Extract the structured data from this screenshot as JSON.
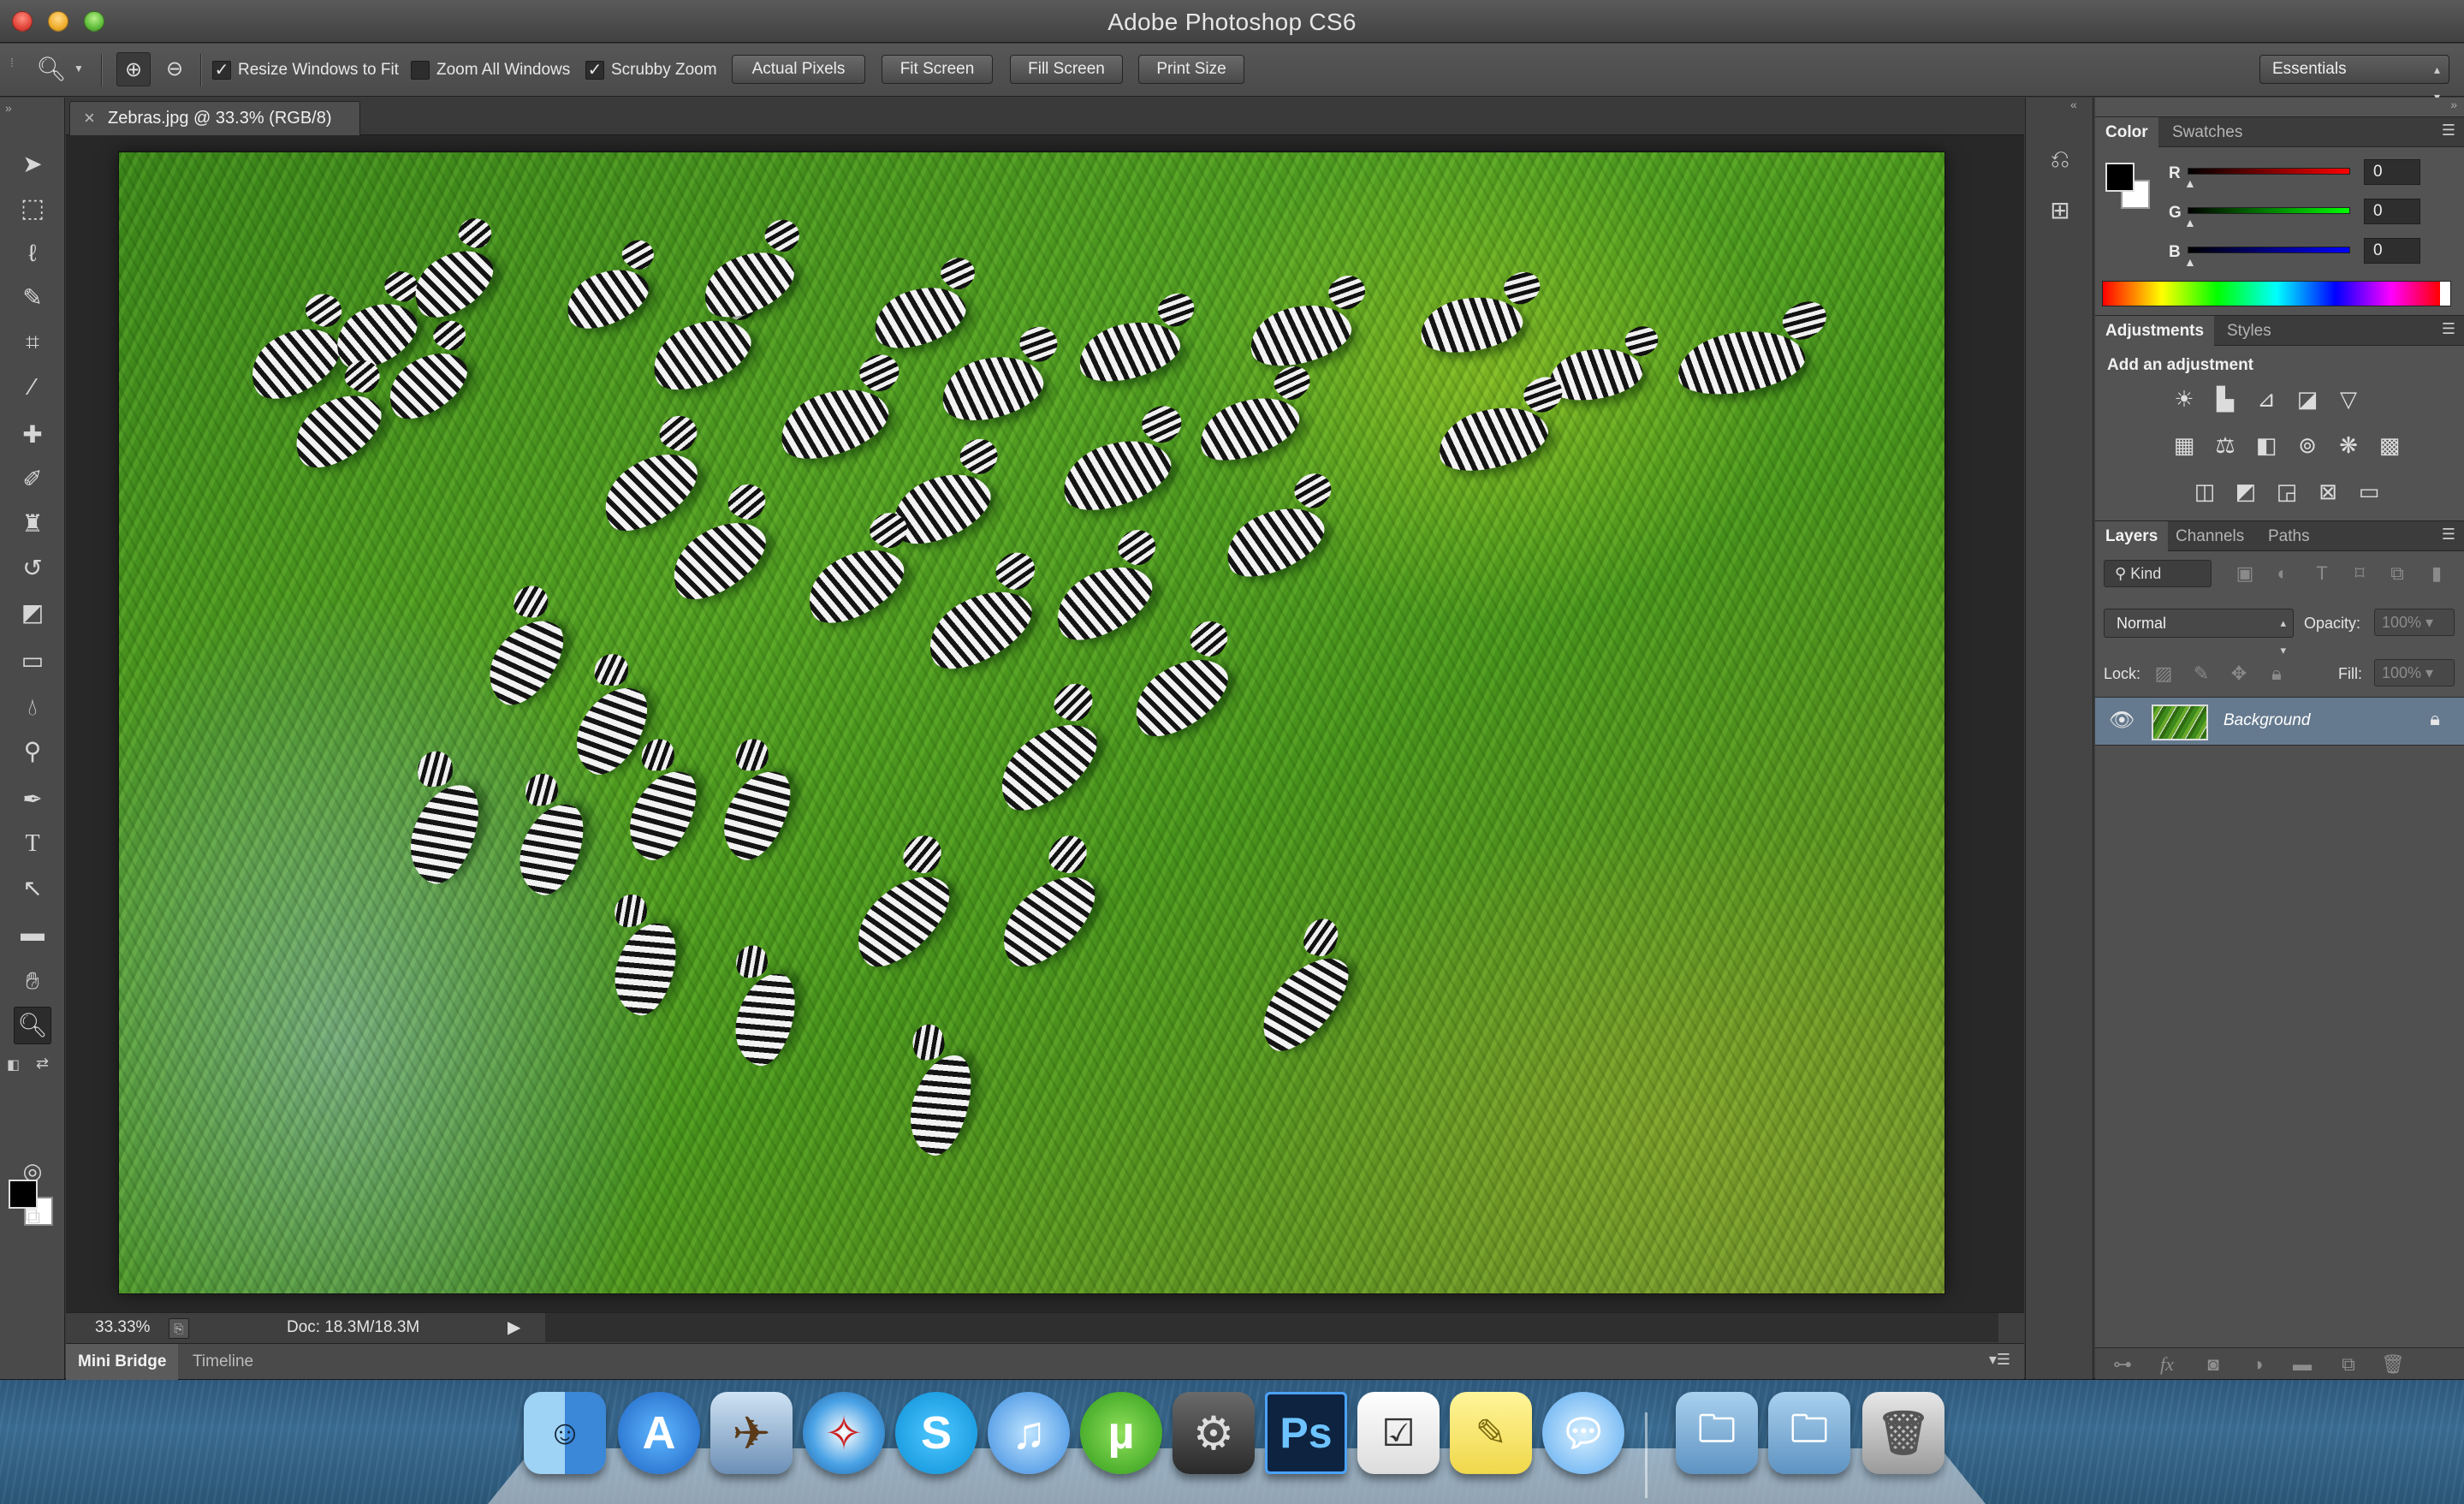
{
  "window": {
    "app_title": "Adobe Photoshop CS6"
  },
  "options_bar": {
    "resize_windows_label": "Resize Windows to Fit",
    "resize_windows_checked": true,
    "zoom_all_windows_label": "Zoom All Windows",
    "zoom_all_windows_checked": false,
    "scrubby_zoom_label": "Scrubby Zoom",
    "scrubby_zoom_checked": true,
    "buttons": [
      "Actual Pixels",
      "Fit Screen",
      "Fill Screen",
      "Print Size"
    ],
    "workspace": "Essentials"
  },
  "toolbar": {
    "tools": [
      "move",
      "marquee",
      "lasso",
      "quick-selection",
      "crop",
      "eyedropper",
      "spot-healing",
      "brush",
      "clone-stamp",
      "history-brush",
      "eraser",
      "gradient",
      "blur",
      "dodge",
      "pen",
      "type",
      "path-selection",
      "rectangle",
      "hand",
      "zoom"
    ],
    "active_tool": "zoom",
    "foreground_color": "#000000",
    "background_color": "#ffffff"
  },
  "document": {
    "tab_title": "Zebras.jpg @ 33.3% (RGB/8)",
    "zoom": "33.33%",
    "doc_size": "Doc: 18.3M/18.3M"
  },
  "bottom_panel": {
    "tabs": [
      "Mini Bridge",
      "Timeline"
    ],
    "active_tab": "Mini Bridge"
  },
  "color_panel": {
    "tabs": [
      "Color",
      "Swatches"
    ],
    "active_tab": "Color",
    "r_label": "R",
    "r_value": "0",
    "g_label": "G",
    "g_value": "0",
    "b_label": "B",
    "b_value": "0"
  },
  "adjustments_panel": {
    "tabs": [
      "Adjustments",
      "Styles"
    ],
    "active_tab": "Adjustments",
    "title": "Add an adjustment"
  },
  "layers_panel": {
    "tabs": [
      "Layers",
      "Channels",
      "Paths"
    ],
    "active_tab": "Layers",
    "filter_kind": "Kind",
    "blend_mode": "Normal",
    "opacity_label": "Opacity:",
    "opacity_value": "100%",
    "lock_label": "Lock:",
    "fill_label": "Fill:",
    "fill_value": "100%",
    "layers": [
      {
        "name": "Background",
        "visible": true,
        "locked": true
      }
    ]
  },
  "dock": {
    "apps": [
      "Finder",
      "App Store",
      "Preview",
      "Safari",
      "Skype",
      "iTunes",
      "uTorrent",
      "Steam",
      "Photoshop",
      "Reminders",
      "Stickies",
      "Messages",
      "Documents",
      "Downloads",
      "Trash"
    ]
  },
  "colors": {
    "panel_bg": "#535353",
    "window_bg": "#3b3b3b",
    "selected_layer": "#657a8f"
  }
}
